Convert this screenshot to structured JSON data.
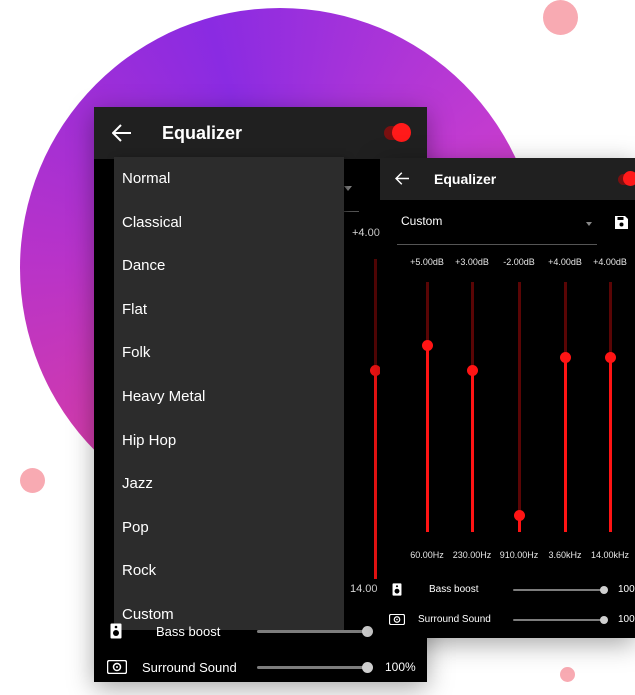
{
  "colors": {
    "accent": "#ff1414",
    "appbar": "#202020",
    "dropdown_bg": "#2c2c2c",
    "background_ring": "#b833c9"
  },
  "phone_left": {
    "title": "Equalizer",
    "back_icon": "arrow-left-icon",
    "toggle_on": true,
    "preset_menu": [
      "Normal",
      "Classical",
      "Dance",
      "Flat",
      "Folk",
      "Heavy Metal",
      "Hip Hop",
      "Jazz",
      "Pop",
      "Rock",
      "Custom"
    ],
    "partial_db": "+4.00",
    "partial_hz": "14.00",
    "bass_boost_label": "Bass boost",
    "surround_label": "Surround Sound",
    "surround_value": "100%"
  },
  "phone_right": {
    "title": "Equalizer",
    "back_icon": "arrow-left-icon",
    "toggle_on": true,
    "preset_selected": "Custom",
    "save_icon": "save-icon",
    "bands": [
      {
        "db": "+5.00dB",
        "hz": "60.00Hz",
        "level": 0.75
      },
      {
        "db": "+3.00dB",
        "hz": "230.00Hz",
        "level": 0.65
      },
      {
        "db": "-2.00dB",
        "hz": "910.00Hz",
        "level": 0.07
      },
      {
        "db": "+4.00dB",
        "hz": "3.60kHz",
        "level": 0.7
      },
      {
        "db": "+4.00dB",
        "hz": "14.00kHz",
        "level": 0.7
      }
    ],
    "bass_boost_label": "Bass boost",
    "bass_boost_value": "100",
    "surround_label": "Surround Sound",
    "surround_value": "100"
  }
}
